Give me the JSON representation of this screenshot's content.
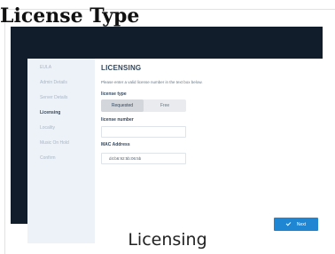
{
  "page": {
    "title": "License Type",
    "caption": "Licensing"
  },
  "sidebar": {
    "items": [
      {
        "label": "EULA",
        "active": false
      },
      {
        "label": "Admin Details",
        "active": false
      },
      {
        "label": "Server Details",
        "active": false
      },
      {
        "label": "Licensing",
        "active": true
      },
      {
        "label": "Locality",
        "active": false
      },
      {
        "label": "Music On Hold",
        "active": false
      },
      {
        "label": "Confirm",
        "active": false
      }
    ]
  },
  "licensing": {
    "section_title": "LICENSING",
    "instruction": "Please enter a valid license number in the text box below.",
    "license_type_label": "license type",
    "license_type_options": [
      "Requested",
      "Free"
    ],
    "license_type_selected": "Requested",
    "license_number_label": "license number",
    "license_number_value": "",
    "mac_label": "MAC Address",
    "mac_value": "d4:b6:92:5b:06:5b"
  },
  "footer": {
    "next_label": "Next",
    "next_icon": "check-icon"
  },
  "colors": {
    "accent": "#1f86d4",
    "sidebar_bg": "#edf2f8",
    "frame_bg": "#121d2b"
  }
}
